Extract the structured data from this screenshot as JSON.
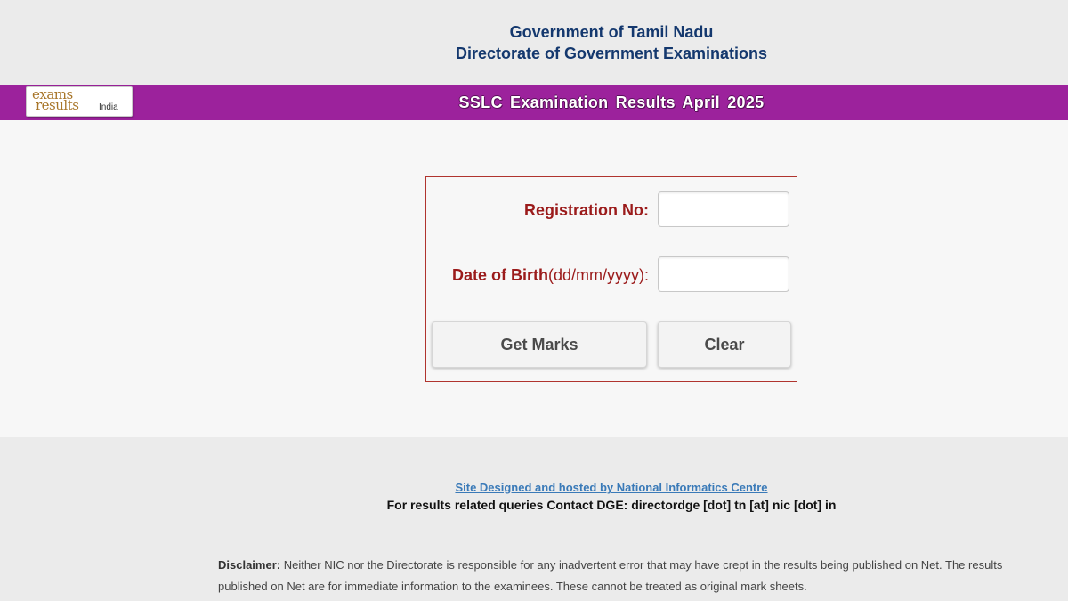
{
  "header": {
    "line1": "Government of Tamil Nadu",
    "line2": "Directorate of Government Examinations"
  },
  "logo": {
    "word1": "exams",
    "word2": "results",
    "word3": "India"
  },
  "banner": {
    "title": "SSLC  Examination Results  April 2025",
    "color": "#9c229c"
  },
  "form": {
    "registration_label": "Registration No:",
    "registration_value": "",
    "dob_label_main": "Date of Birth",
    "dob_label_format": "(dd/mm/yyyy):",
    "dob_value": "",
    "get_marks_label": "Get Marks",
    "clear_label": "Clear",
    "label_color": "#9b1b1b",
    "border_color": "#b0342e"
  },
  "footer": {
    "nic_link": "Site Designed and hosted by National Informatics Centre",
    "contact": "For results related queries Contact DGE:  directordge [dot] tn [at] nic [dot] in",
    "disclaimer_label": "Disclaimer:",
    "disclaimer_text": " Neither NIC nor the Directorate is responsible for any inadvertent error that may have crept in the results being published on Net. The results published on Net are for immediate information to the examinees. These cannot be treated as original mark sheets."
  }
}
